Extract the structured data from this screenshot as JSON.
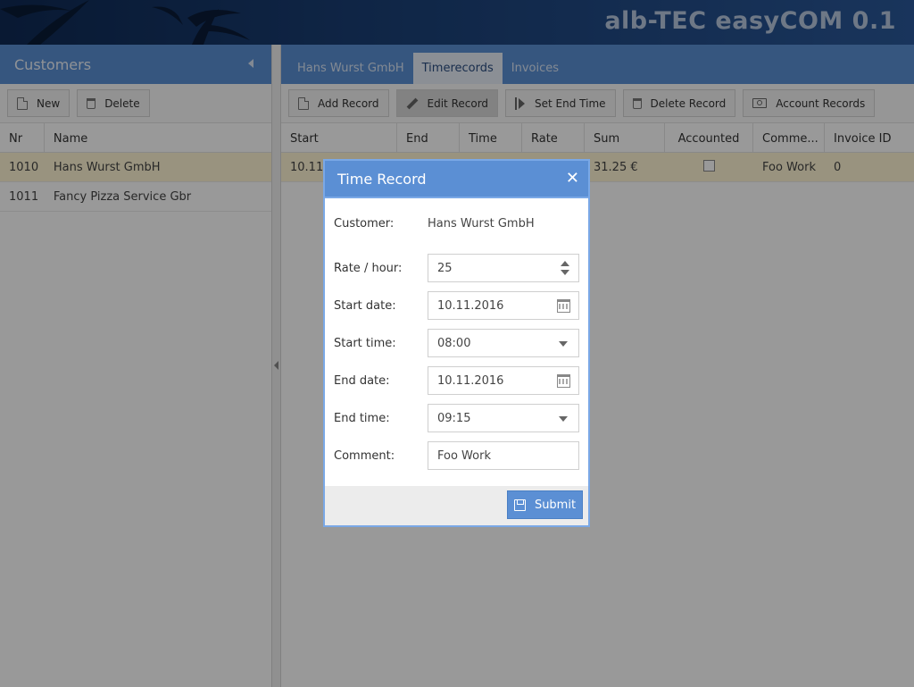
{
  "app": {
    "title": "alb-TEC easyCOM 0.1"
  },
  "customers_panel": {
    "title": "Customers",
    "toolbar": {
      "new_label": "New",
      "delete_label": "Delete"
    },
    "columns": [
      "Nr",
      "Name"
    ],
    "rows": [
      {
        "nr": "1010",
        "name": "Hans Wurst GmbH",
        "selected": true
      },
      {
        "nr": "1011",
        "name": "Fancy Pizza Service Gbr",
        "selected": false
      }
    ]
  },
  "tabs": [
    {
      "label": "Hans Wurst GmbH",
      "active": false
    },
    {
      "label": "Timerecords",
      "active": true
    },
    {
      "label": "Invoices",
      "active": false
    }
  ],
  "records_toolbar": {
    "add_label": "Add Record",
    "edit_label": "Edit Record",
    "set_end_label": "Set End Time",
    "delete_label": "Delete Record",
    "account_label": "Account Records"
  },
  "records_table": {
    "columns": [
      "Start",
      "End",
      "Time",
      "Rate",
      "Sum",
      "Accounted",
      "Comme...",
      "Invoice ID"
    ],
    "rows": [
      {
        "start": "10.11.",
        "end": "",
        "time": "",
        "rate": "",
        "sum": "31.25 €",
        "accounted": false,
        "comment": "Foo Work",
        "invoice_id": "0"
      }
    ]
  },
  "modal": {
    "title": "Time Record",
    "customer_label": "Customer:",
    "customer_value": "Hans Wurst GmbH",
    "rate_label": "Rate / hour:",
    "rate_value": "25",
    "start_date_label": "Start date:",
    "start_date_value": "10.11.2016",
    "start_time_label": "Start time:",
    "start_time_value": "08:00",
    "end_date_label": "End date:",
    "end_date_value": "10.11.2016",
    "end_time_label": "End time:",
    "end_time_value": "09:15",
    "comment_label": "Comment:",
    "comment_value": "Foo Work",
    "submit_label": "Submit"
  },
  "colors": {
    "accent": "#5b8fd4",
    "header_dark": "#0f2a55",
    "selected_row": "#fff6d4"
  }
}
